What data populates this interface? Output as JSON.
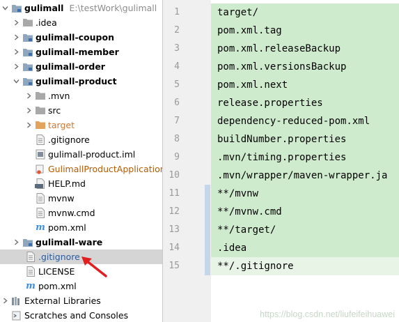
{
  "tree": {
    "root": {
      "name": "gulimall",
      "path": "E:\\testWork\\gulimall"
    },
    "items": [
      {
        "label": ".idea"
      },
      {
        "label": "gulimall-coupon"
      },
      {
        "label": "gulimall-member"
      },
      {
        "label": "gulimall-order"
      },
      {
        "label": "gulimall-product"
      },
      {
        "label": ".mvn"
      },
      {
        "label": "src"
      },
      {
        "label": "target"
      },
      {
        "label": ".gitignore"
      },
      {
        "label": "gulimall-product.iml"
      },
      {
        "label": "GulimallProductApplication."
      },
      {
        "label": "HELP.md"
      },
      {
        "label": "mvnw"
      },
      {
        "label": "mvnw.cmd"
      },
      {
        "label": "pom.xml"
      },
      {
        "label": "gulimall-ware"
      },
      {
        "label": ".gitignore"
      },
      {
        "label": "LICENSE"
      },
      {
        "label": "pom.xml"
      },
      {
        "label": "External Libraries"
      },
      {
        "label": "Scratches and Consoles"
      }
    ],
    "md_badge": "MD",
    "maven_glyph": "m"
  },
  "editor": {
    "lines": [
      {
        "num": "1",
        "text": "target/"
      },
      {
        "num": "2",
        "text": "pom.xml.tag"
      },
      {
        "num": "3",
        "text": "pom.xml.releaseBackup"
      },
      {
        "num": "4",
        "text": "pom.xml.versionsBackup"
      },
      {
        "num": "5",
        "text": "pom.xml.next"
      },
      {
        "num": "6",
        "text": "release.properties"
      },
      {
        "num": "7",
        "text": "dependency-reduced-pom.xml"
      },
      {
        "num": "8",
        "text": "buildNumber.properties"
      },
      {
        "num": "9",
        "text": ".mvn/timing.properties"
      },
      {
        "num": "10",
        "text": ".mvn/wrapper/maven-wrapper.ja"
      },
      {
        "num": "11",
        "text": "**/mvnw"
      },
      {
        "num": "12",
        "text": "**/mvnw.cmd"
      },
      {
        "num": "13",
        "text": "**/target/"
      },
      {
        "num": "14",
        "text": ".idea"
      },
      {
        "num": "15",
        "text": "**/.gitignore"
      }
    ],
    "watermark": "https://blog.csdn.net/liufeifeihuawei"
  },
  "colors": {
    "added_line": "#cfebcd",
    "modified_gutter": "#c5d6ea",
    "selection": "#d5d5d5",
    "annotation_arrow": "#e02020"
  }
}
